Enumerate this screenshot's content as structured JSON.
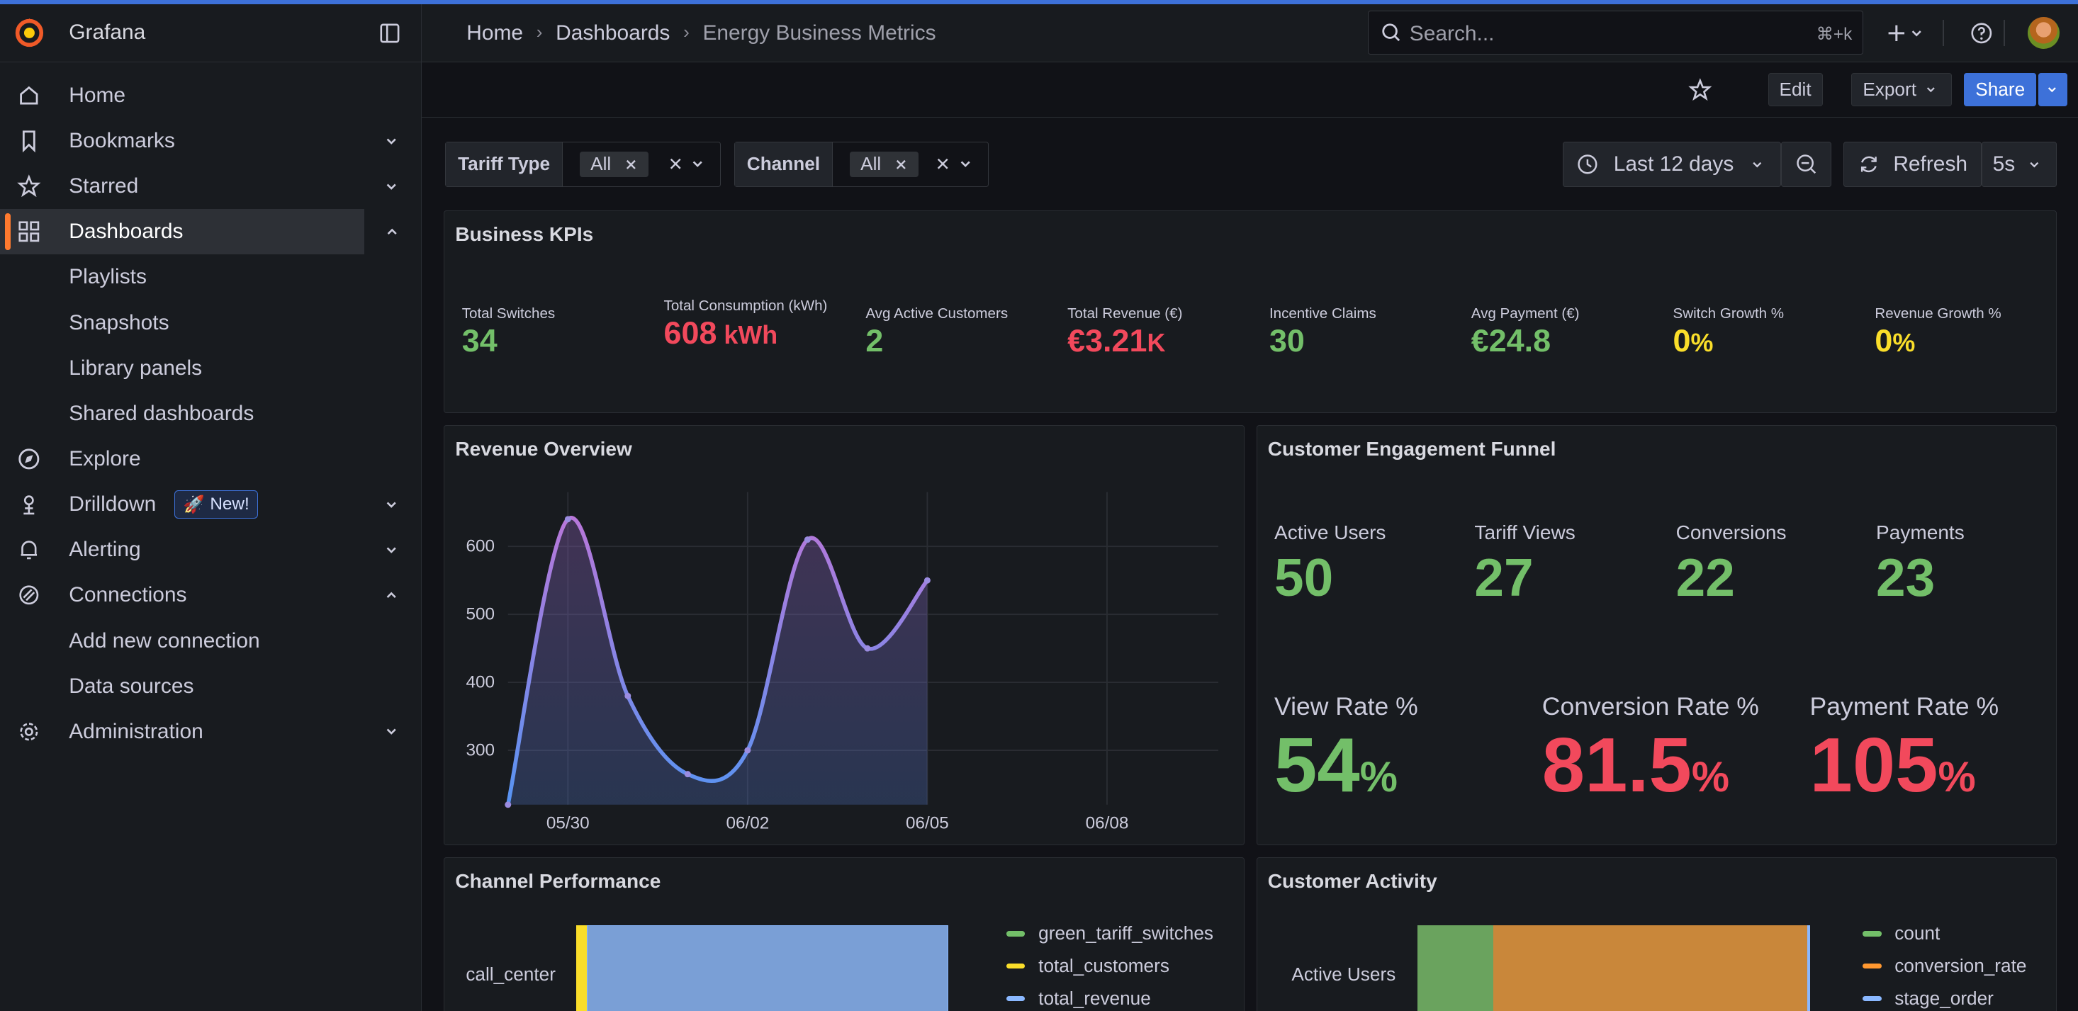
{
  "app": {
    "name": "Grafana"
  },
  "sidebar": {
    "items": [
      {
        "label": "Home",
        "icon": "home-icon"
      },
      {
        "label": "Bookmarks",
        "icon": "bookmark-icon"
      },
      {
        "label": "Starred",
        "icon": "star-icon"
      },
      {
        "label": "Dashboards",
        "icon": "apps-icon"
      },
      {
        "label": "Playlists"
      },
      {
        "label": "Snapshots"
      },
      {
        "label": "Library panels"
      },
      {
        "label": "Shared dashboards"
      },
      {
        "label": "Explore",
        "icon": "compass-icon"
      },
      {
        "label": "Drilldown",
        "icon": "drilldown-icon",
        "badge": "New!"
      },
      {
        "label": "Alerting",
        "icon": "bell-icon"
      },
      {
        "label": "Connections",
        "icon": "connections-icon"
      },
      {
        "label": "Add new connection"
      },
      {
        "label": "Data sources"
      },
      {
        "label": "Administration",
        "icon": "cog-icon"
      }
    ]
  },
  "header": {
    "breadcrumbs": [
      "Home",
      "Dashboards",
      "Energy Business Metrics"
    ],
    "search_placeholder": "Search...",
    "search_shortcut": "⌘+k"
  },
  "toolbar": {
    "edit": "Edit",
    "export": "Export",
    "share": "Share"
  },
  "variables": [
    {
      "label": "Tariff Type",
      "value": "All"
    },
    {
      "label": "Channel",
      "value": "All"
    }
  ],
  "time": {
    "range": "Last 12 days",
    "refresh": "Refresh",
    "interval": "5s"
  },
  "kpis": {
    "title": "Business KPIs",
    "items": [
      {
        "label": "Total Switches",
        "value": "34",
        "unit": "",
        "color": "#73bf69"
      },
      {
        "label": "Total Consumption (kWh)",
        "value": "608",
        "unit": " kWh",
        "color": "#f2495c"
      },
      {
        "label": "Avg Active Customers",
        "value": "2",
        "unit": "",
        "color": "#73bf69"
      },
      {
        "label": "Total Revenue (€)",
        "value": "€3.21",
        "unit": "K",
        "color": "#f2495c"
      },
      {
        "label": "Incentive Claims",
        "value": "30",
        "unit": "",
        "color": "#73bf69"
      },
      {
        "label": "Avg Payment (€)",
        "value": "€24.8",
        "unit": "",
        "color": "#73bf69"
      },
      {
        "label": "Switch Growth %",
        "value": "0",
        "unit": "%",
        "color": "#fade2a"
      },
      {
        "label": "Revenue Growth %",
        "value": "0",
        "unit": "%",
        "color": "#fade2a"
      }
    ]
  },
  "revenue": {
    "title": "Revenue Overview",
    "chart_data": {
      "type": "line",
      "x": [
        "05/29",
        "05/30",
        "05/31",
        "06/01",
        "06/02",
        "06/03",
        "06/04",
        "06/05"
      ],
      "series": [
        {
          "values": [
            220,
            640,
            380,
            265,
            300,
            610,
            450,
            550
          ]
        }
      ],
      "xticks": [
        "05/30",
        "06/02",
        "06/05",
        "06/08"
      ],
      "yticks": [
        300,
        400,
        500,
        600
      ],
      "ylim": [
        220,
        680
      ],
      "grid": true
    }
  },
  "funnel": {
    "title": "Customer Engagement Funnel",
    "stats": [
      {
        "label": "Active Users",
        "value": "50"
      },
      {
        "label": "Tariff Views",
        "value": "27"
      },
      {
        "label": "Conversions",
        "value": "22"
      },
      {
        "label": "Payments",
        "value": "23"
      }
    ],
    "rates": [
      {
        "label": "View Rate %",
        "value": "54",
        "unit": "%",
        "color": "#73bf69"
      },
      {
        "label": "Conversion Rate %",
        "value": "81.5",
        "unit": "%",
        "color": "#f2495c"
      },
      {
        "label": "Payment Rate %",
        "value": "105",
        "unit": "%",
        "color": "#f2495c"
      }
    ]
  },
  "channel": {
    "title": "Channel Performance",
    "row_label": "call_center",
    "legend": [
      {
        "name": "green_tariff_switches",
        "color": "#73bf69"
      },
      {
        "name": "total_customers",
        "color": "#fade2a"
      },
      {
        "name": "total_revenue",
        "color": "#8ab8ff"
      }
    ]
  },
  "activity": {
    "title": "Customer Activity",
    "row_label": "Active Users",
    "legend": [
      {
        "name": "count",
        "color": "#73bf69"
      },
      {
        "name": "conversion_rate",
        "color": "#ff9830"
      },
      {
        "name": "stage_order",
        "color": "#8ab8ff"
      }
    ]
  }
}
